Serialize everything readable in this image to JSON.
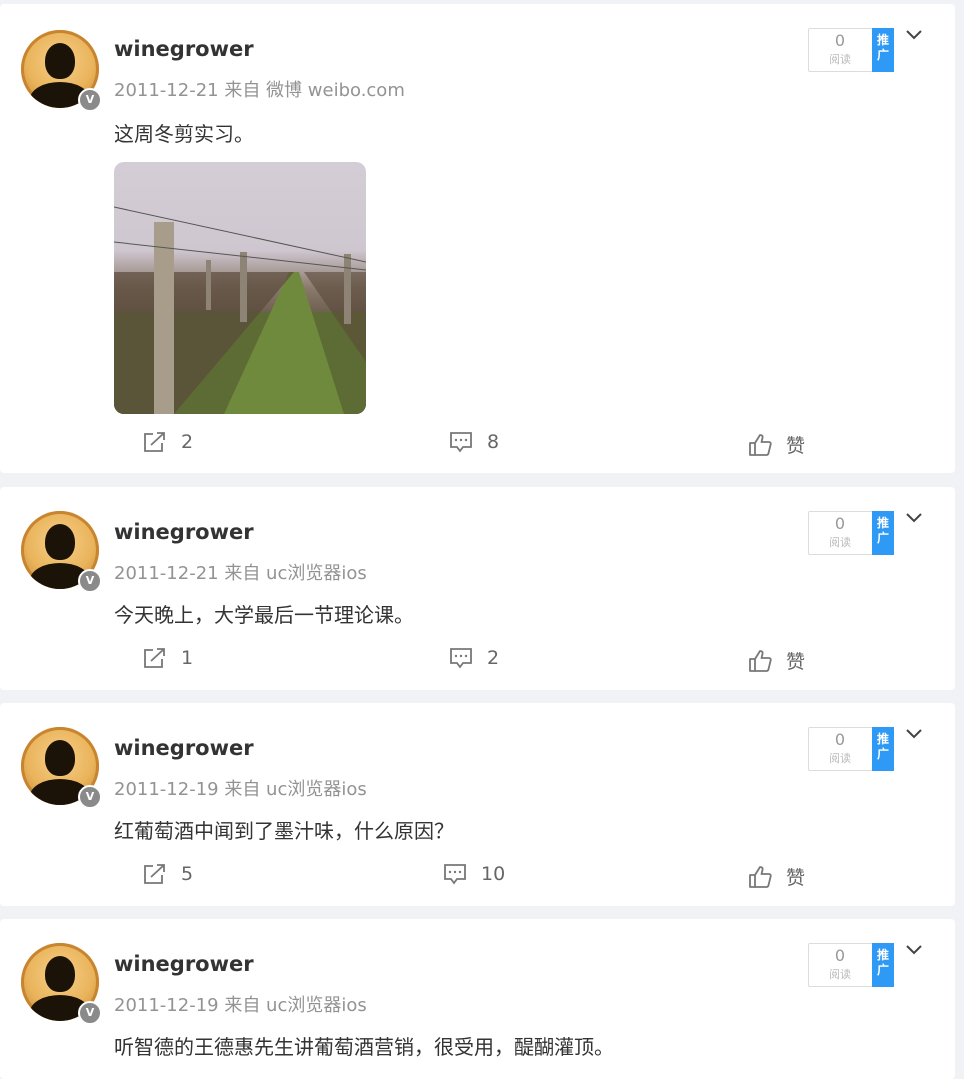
{
  "posts": [
    {
      "username": "winegrower",
      "meta": "2011-12-21 来自 微博 weibo.com",
      "text": "这周冬剪实习。",
      "has_image": true,
      "read_count": "0",
      "read_label": "阅读",
      "promo_label": "推广",
      "share_count": "2",
      "comment_count": "8",
      "like_label": "赞"
    },
    {
      "username": "winegrower",
      "meta": "2011-12-21 来自 uc浏览器ios",
      "text": "今天晚上，大学最后一节理论课。",
      "has_image": false,
      "read_count": "0",
      "read_label": "阅读",
      "promo_label": "推广",
      "share_count": "1",
      "comment_count": "2",
      "like_label": "赞"
    },
    {
      "username": "winegrower",
      "meta": "2011-12-19 来自 uc浏览器ios",
      "text": "红葡萄酒中闻到了墨汁味，什么原因？",
      "has_image": false,
      "read_count": "0",
      "read_label": "阅读",
      "promo_label": "推广",
      "share_count": "5",
      "comment_count": "10",
      "like_label": "赞"
    },
    {
      "username": "winegrower",
      "meta": "2011-12-19 来自 uc浏览器ios",
      "text": "听智德的王德惠先生讲葡萄酒营销，很受用，醍醐灌顶。",
      "has_image": false,
      "read_count": "0",
      "read_label": "阅读",
      "promo_label": "推广",
      "share_count": "",
      "comment_count": "",
      "like_label": ""
    }
  ],
  "icons": {
    "verified": "v-badge-icon",
    "share": "share-icon",
    "comment": "comment-icon",
    "like": "thumbs-up-icon",
    "expand": "chevron-down-icon"
  },
  "colors": {
    "promo": "#2f9af5",
    "meta_text": "#939393",
    "background": "#f1f2f5"
  }
}
